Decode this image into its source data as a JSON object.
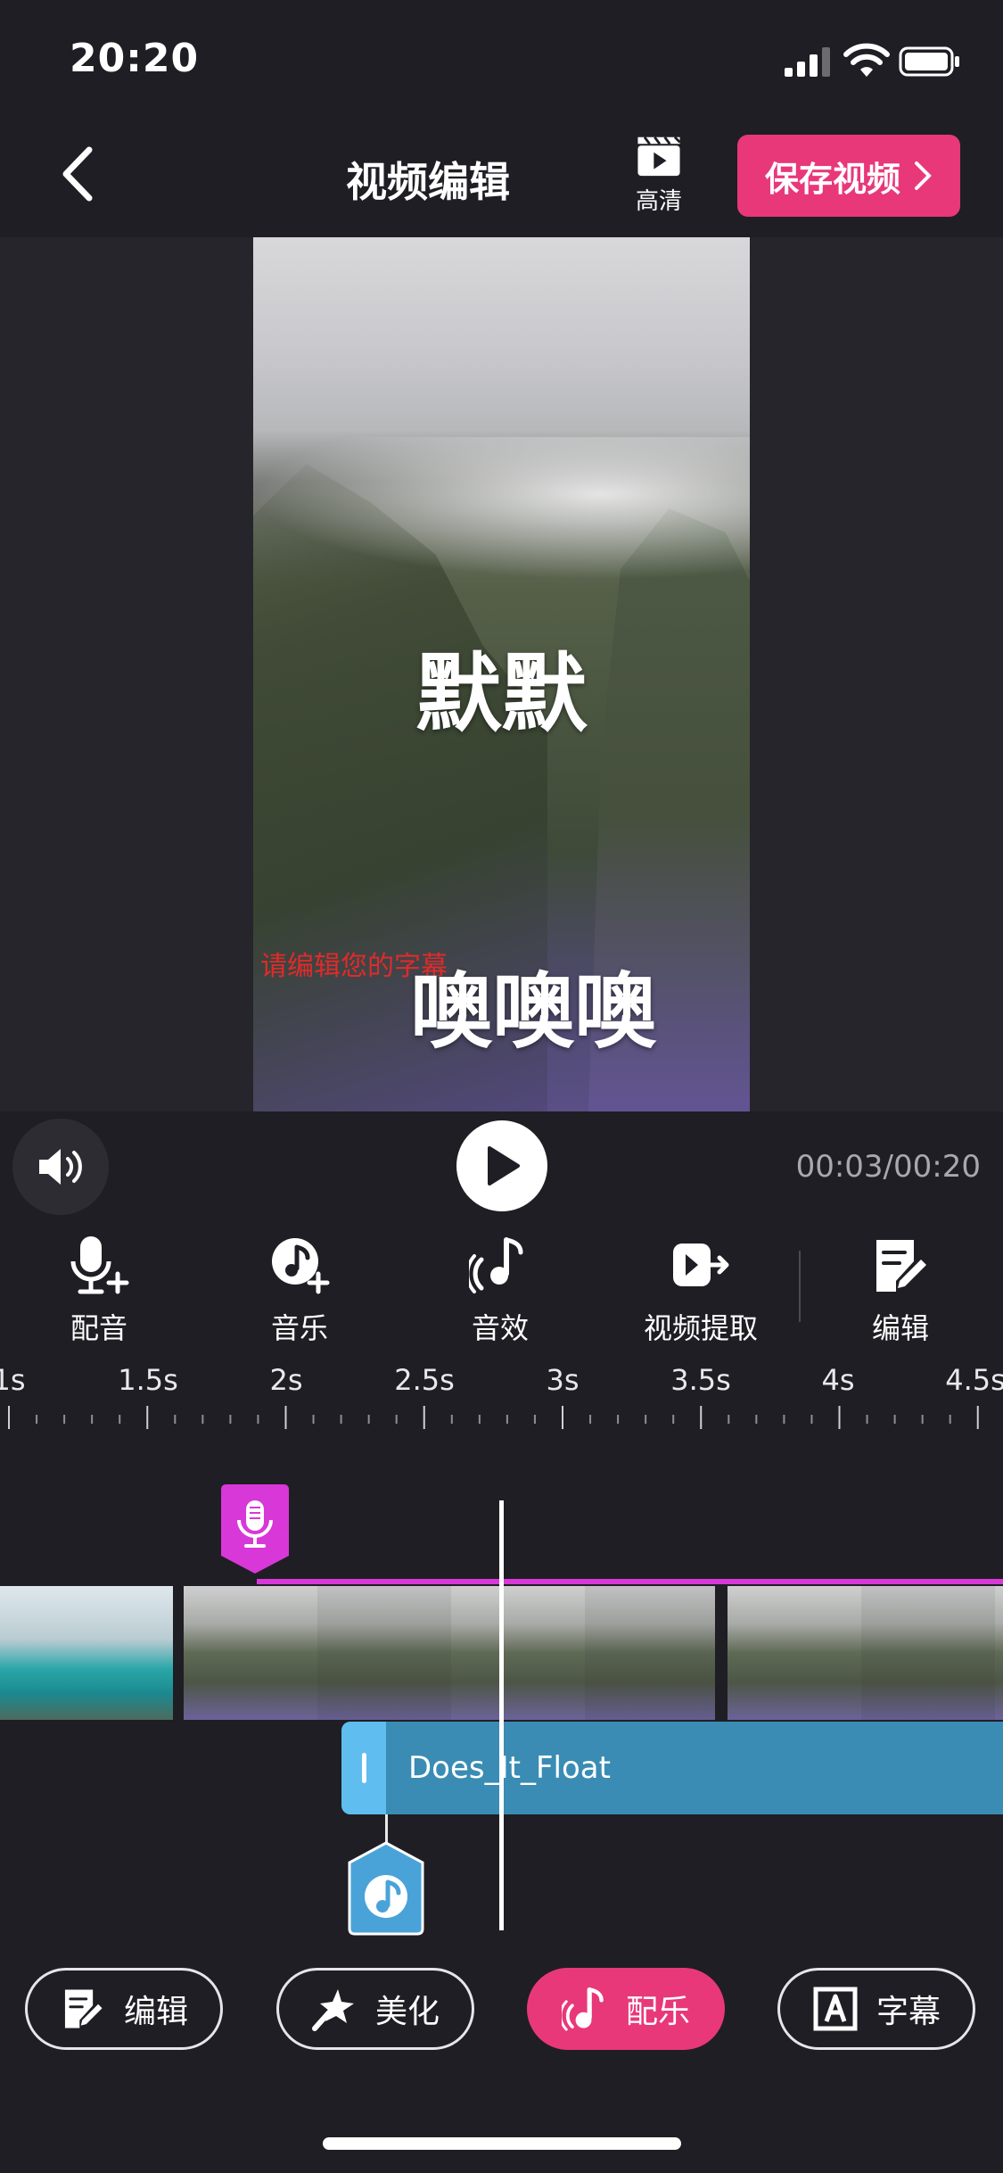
{
  "status_bar": {
    "time": "20:20"
  },
  "header": {
    "title": "视频编辑",
    "hd_label": "高清",
    "save_label": "保存视频"
  },
  "preview": {
    "overlay_text_1": "默默",
    "overlay_text_2": "噢噢噢",
    "subtitle_placeholder": "请编辑您的字幕"
  },
  "player": {
    "time": "00:03/00:20"
  },
  "tools": [
    {
      "label": "配音",
      "icon": "mic-add-icon"
    },
    {
      "label": "音乐",
      "icon": "music-add-icon"
    },
    {
      "label": "音效",
      "icon": "sound-effect-icon"
    },
    {
      "label": "视频提取",
      "icon": "video-extract-icon"
    },
    {
      "label": "编辑",
      "icon": "edit-icon"
    }
  ],
  "timeline": {
    "ticks": [
      "1s",
      "1.5s",
      "2s",
      "2.5s",
      "3s",
      "3.5s",
      "4s",
      "4.5s"
    ],
    "music_track_name": "Does_It_Float"
  },
  "bottom_tabs": [
    {
      "label": "编辑",
      "icon": "edit-icon",
      "active": false
    },
    {
      "label": "美化",
      "icon": "magic-wand-icon",
      "active": false
    },
    {
      "label": "配乐",
      "icon": "music-note-icon",
      "active": true
    },
    {
      "label": "字幕",
      "icon": "subtitle-icon",
      "active": false
    }
  ],
  "colors": {
    "accent": "#e8387a",
    "background": "#1f1e24",
    "music_track": "#3a8cb4",
    "voice_track": "#d838d8"
  }
}
